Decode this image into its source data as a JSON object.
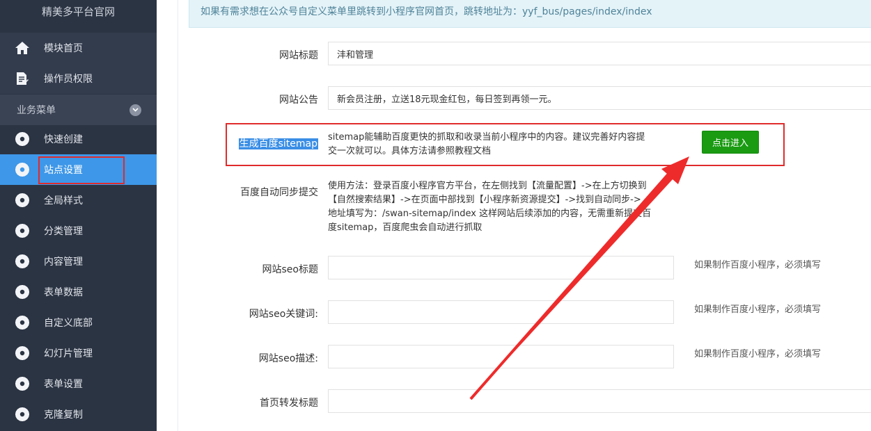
{
  "sidebar": {
    "title": "精美多平台官网",
    "items": [
      {
        "label": "模块首页",
        "icon": "home-icon"
      },
      {
        "label": "操作员权限",
        "icon": "document-edit-icon"
      }
    ],
    "group_label": "业务菜单",
    "group_items": [
      {
        "label": "快速创建"
      },
      {
        "label": "站点设置"
      },
      {
        "label": "全局样式"
      },
      {
        "label": "分类管理"
      },
      {
        "label": "内容管理"
      },
      {
        "label": "表单数据"
      },
      {
        "label": "自定义底部"
      },
      {
        "label": "幻灯片管理"
      },
      {
        "label": "表单设置"
      },
      {
        "label": "克隆复制"
      }
    ],
    "active_item": "站点设置"
  },
  "notice": {
    "text": "如果有需求想在公众号自定义菜单里跳转到小程序官网首页，跳转地址为：yyf_bus/pages/index/index"
  },
  "form": {
    "site_title": {
      "label": "网站标题",
      "value": "沣和管理"
    },
    "site_notice": {
      "label": "网站公告",
      "value": "新会员注册，立送18元现金红包，每日签到再领一元。"
    },
    "sitemap": {
      "label": "生成百度sitemap",
      "desc_line1": "sitemap能辅助百度更快的抓取和收录当前小程序中的内容。建议完善好内容提",
      "desc_line2": "交一次就可以。具体方法请参照教程文档",
      "button": "点击进入"
    },
    "baidu_sync": {
      "label": "百度自动同步提交",
      "lines": [
        "使用方法：登录百度小程序官方平台，在左侧找到【流量配置】->在上方切换到",
        "【自然搜索结果】->在页面中部找到【小程序新资源提交】->找到自动同步->",
        "地址填写为：/swan-sitemap/index 这样网站后续添加的内容，无需重新提交百",
        "度sitemap，百度爬虫会自动进行抓取"
      ]
    },
    "seo_title": {
      "label": "网站seo标题",
      "value": "",
      "hint": "如果制作百度小程序，必须填写"
    },
    "seo_keywords": {
      "label": "网站seo关键词:",
      "value": "",
      "hint": "如果制作百度小程序，必须填写"
    },
    "seo_desc": {
      "label": "网站seo描述:",
      "value": "",
      "hint": "如果制作百度小程序，必须填写"
    },
    "share_title": {
      "label": "首页转发标题",
      "value": ""
    }
  },
  "colors": {
    "sidebar_bg": "#2b3443",
    "active_bg": "#3e97e8",
    "button_green": "#1a9b12",
    "annotation_red": "#e02b2b"
  }
}
